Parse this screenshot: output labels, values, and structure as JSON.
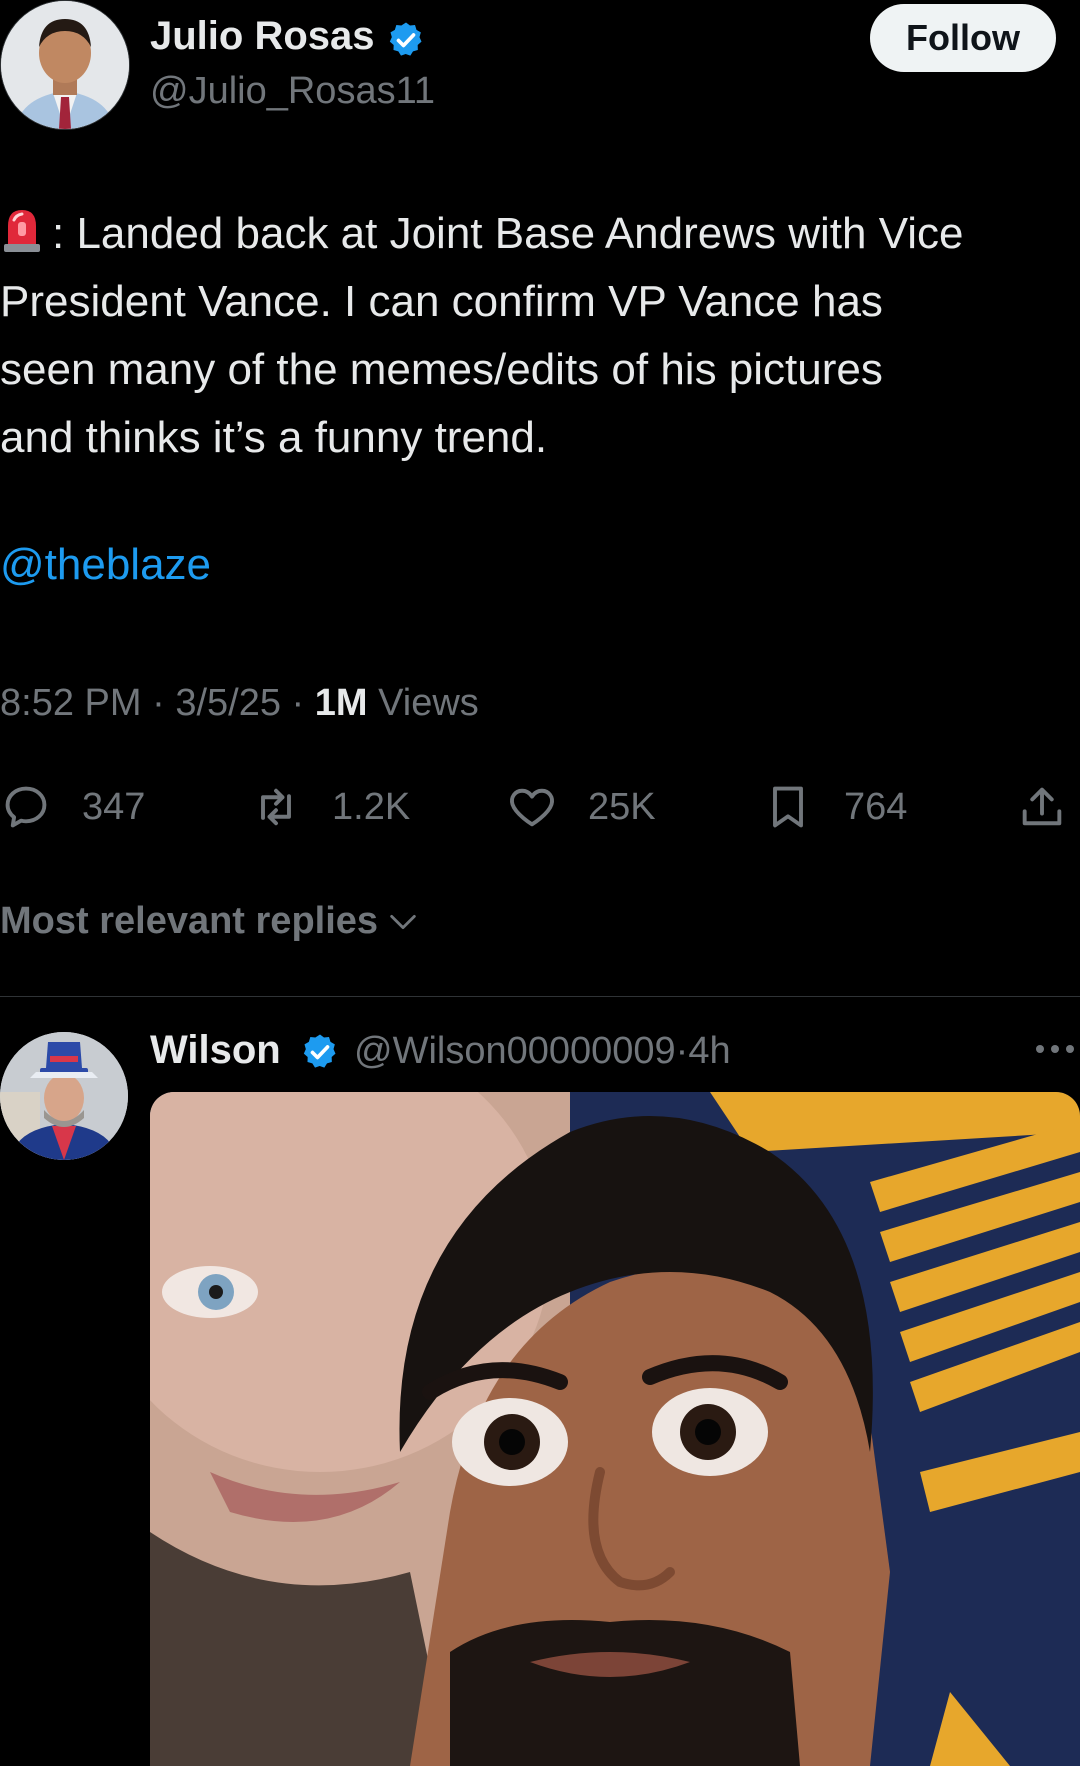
{
  "tweet": {
    "author": {
      "name": "Julio Rosas",
      "handle": "@Julio_Rosas11",
      "avatar_icon": "profile-photo",
      "verified": true
    },
    "follow_label": "Follow",
    "siren_icon": "rotating-light-emoji",
    "text_lines": [
      ": Landed back at Joint Base Andrews with Vice",
      "President Vance. I can confirm VP Vance has",
      "seen many of the memes/edits of his pictures",
      "and thinks it’s a funny trend."
    ],
    "mention": "@theblaze",
    "time": "8:52 PM",
    "date": "3/5/25",
    "separator": "·",
    "views_count": "1M",
    "views_label": "Views",
    "actions": {
      "replies": "347",
      "reposts": "1.2K",
      "likes": "25K",
      "bookmarks": "764"
    }
  },
  "replies_filter": "Most relevant replies",
  "reply": {
    "name": "Wilson",
    "handle": "@Wilson00000009",
    "separator": "·",
    "time": "4h",
    "verified": true,
    "media_icon": "meme-photo"
  },
  "colors": {
    "background": "#000000",
    "text": "#e7e9ea",
    "muted": "#71767b",
    "link": "#1d9bf0",
    "verified": "#1d9bf0"
  }
}
